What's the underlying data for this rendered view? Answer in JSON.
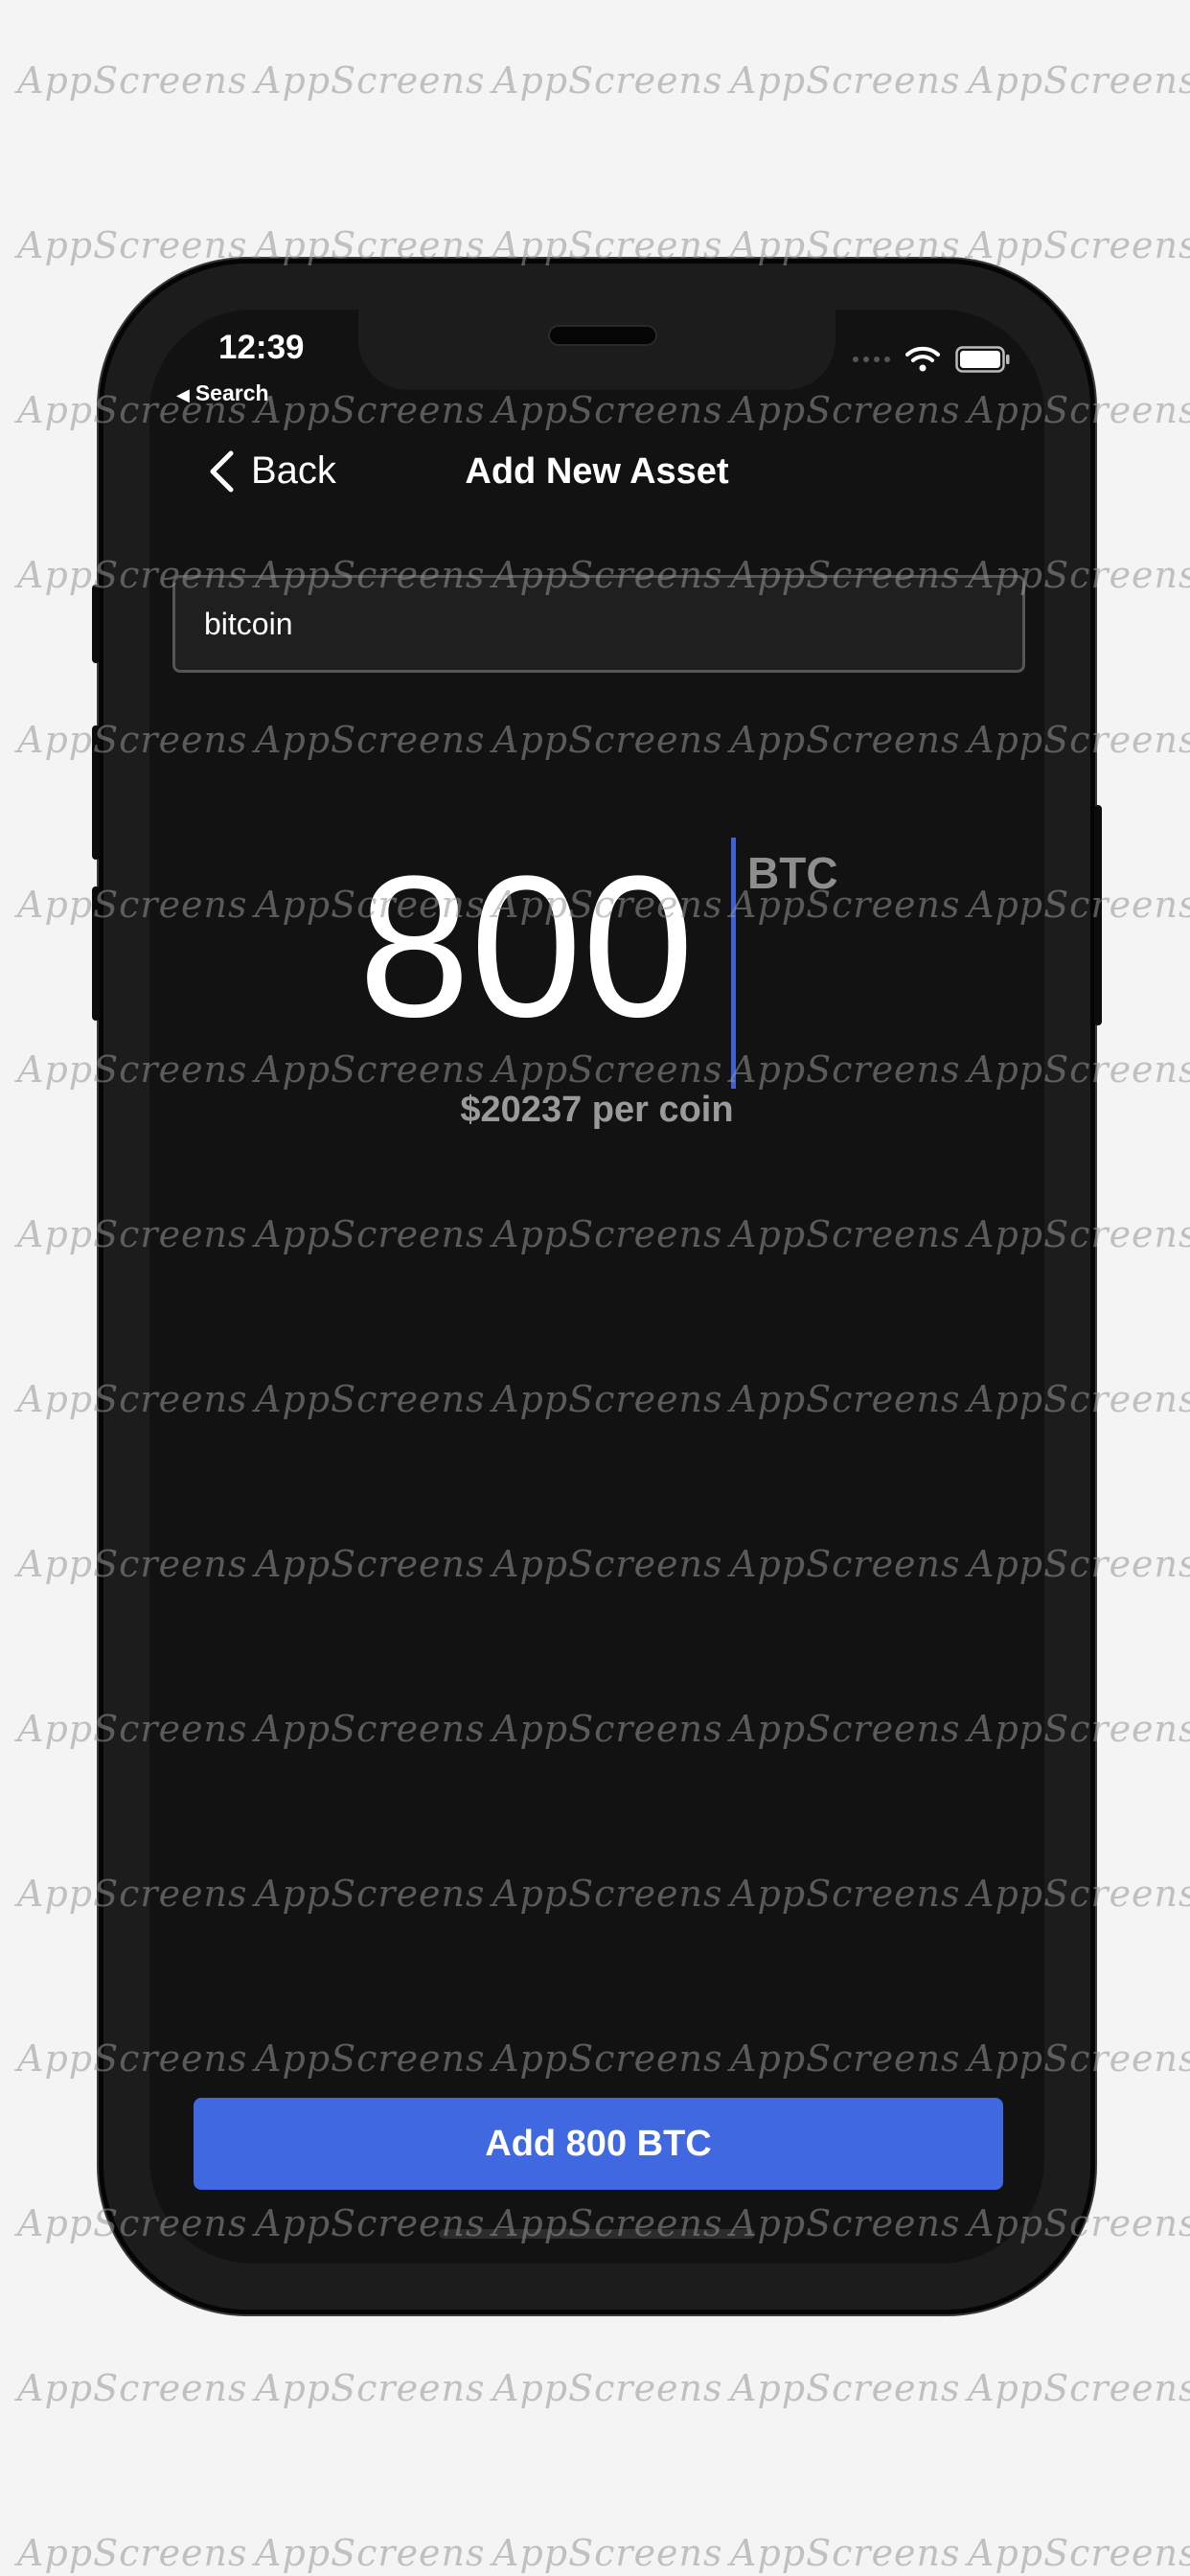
{
  "status_bar": {
    "time": "12:39",
    "back_app": "Search",
    "icons": [
      "cellular-dots-icon",
      "wifi-icon",
      "battery-icon"
    ]
  },
  "nav": {
    "back_label": "Back",
    "title": "Add New Asset"
  },
  "search": {
    "value": "bitcoin"
  },
  "amount": {
    "value": "800",
    "unit": "BTC",
    "price_label": "$20237 per coin"
  },
  "action": {
    "button_label": "Add 800 BTC"
  },
  "watermark": {
    "text": "AppScreens"
  },
  "colors": {
    "accent": "#4068e0",
    "background": "#121212",
    "page_background": "#f4f4f4"
  }
}
